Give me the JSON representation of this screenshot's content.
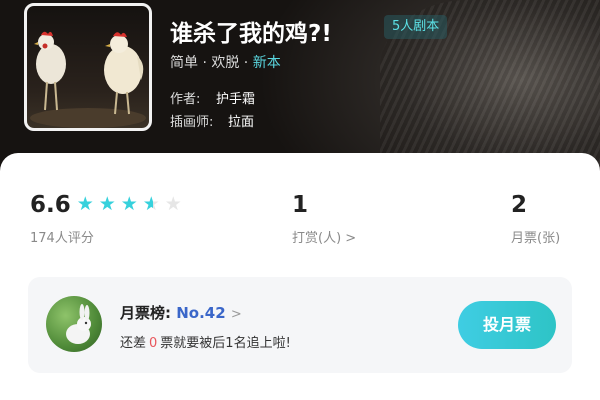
{
  "book": {
    "title": "谁杀了我的鸡?!",
    "badge": "5人剧本",
    "genre_prefix": "简单 · 欢脱 · ",
    "genre_new": "新本",
    "author_label": "作者:",
    "author": "护手霜",
    "illustrator_label": "插画师:",
    "illustrator": "拉面"
  },
  "stats": {
    "rating": "6.6",
    "rating_stars": 3.5,
    "rating_stars_max": 5,
    "rating_count_label": "174人评分",
    "tips_value": "1",
    "tips_label": "打赏(人) >",
    "monthly_value": "2",
    "monthly_label": "月票(张)"
  },
  "rank": {
    "title_label": "月票榜:",
    "rank_no": "No.42",
    "chevron": ">",
    "sub_prefix": "还差",
    "sub_gap": "0",
    "sub_suffix": "票就要被后1名追上啦!",
    "vote_button": "投月票"
  },
  "colors": {
    "accent": "#36d1dc",
    "rank_blue": "#3a66c9",
    "alert_red": "#e8555b"
  }
}
